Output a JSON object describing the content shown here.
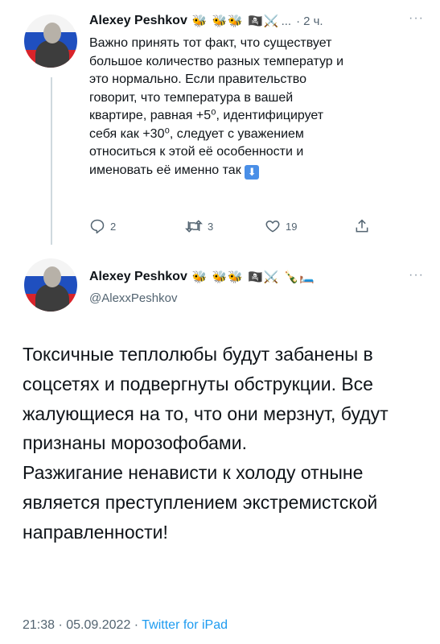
{
  "tweet1": {
    "author_name": "Alexey Peshkov",
    "emojis": "🐝 🐝🐝 🏴‍☠️⚔️",
    "truncation": "...",
    "separator": "·",
    "time": "2 ч.",
    "more": "···",
    "text_lines": [
      "Важно принять тот факт, что существует",
      "большое количество разных температур и",
      "это нормально. Если правительство",
      "говорит, что температура в вашей",
      "квартире, равная +5⁰, идентифицирует",
      "себя как +30⁰, следует с уважением",
      "относиться к этой её особенности и",
      "именовать её именно так"
    ],
    "trailing_emoji": "⬇",
    "reply_count": "2",
    "retweet_count": "3",
    "like_count": "19"
  },
  "tweet2": {
    "author_name": "Alexey Peshkov",
    "emojis": "🐝 🐝🐝 🏴‍☠️⚔️ 🍾🛏️",
    "handle": "@AlexxPeshkov",
    "more": "···",
    "paragraphs": [
      "Токсичные теплолюбы будут забанены в соцсетях и подвергнуты обструкции. Все жалующиеся на то, что они мерзнут, будут признаны морозофобами.",
      "Разжигание ненависти к холоду отныне является преступлением экстремистской направленности!"
    ],
    "timestamp": "21:38 · 05.09.2022",
    "meta_separator": " · ",
    "source": "Twitter for iPad"
  }
}
